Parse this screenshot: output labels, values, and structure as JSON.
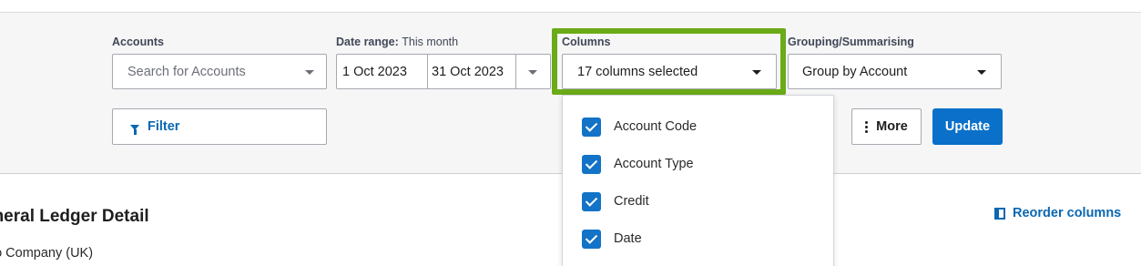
{
  "filters": {
    "accounts": {
      "label": "Accounts",
      "placeholder": "Search for Accounts"
    },
    "date_range": {
      "label": "Date range:",
      "sub_label": "This month",
      "from": "1 Oct 2023",
      "to": "31 Oct 2023"
    },
    "columns": {
      "label": "Columns",
      "value": "17 columns selected"
    },
    "grouping": {
      "label": "Grouping/Summarising",
      "value": "Group by Account"
    }
  },
  "toolbar": {
    "filter_label": "Filter",
    "more_label": "More",
    "update_label": "Update"
  },
  "columns_dropdown": {
    "options": [
      {
        "label": "Account Code",
        "checked": true
      },
      {
        "label": "Account Type",
        "checked": true
      },
      {
        "label": "Credit",
        "checked": true
      },
      {
        "label": "Date",
        "checked": true
      }
    ]
  },
  "report": {
    "title": "eneral Ledger Detail",
    "organisation": "no Company (UK)",
    "reorder_label": "Reorder columns"
  },
  "colors": {
    "accent_blue": "#0a70c9",
    "highlight_green": "#6aab17",
    "checkbox_blue": "#1273c7"
  }
}
